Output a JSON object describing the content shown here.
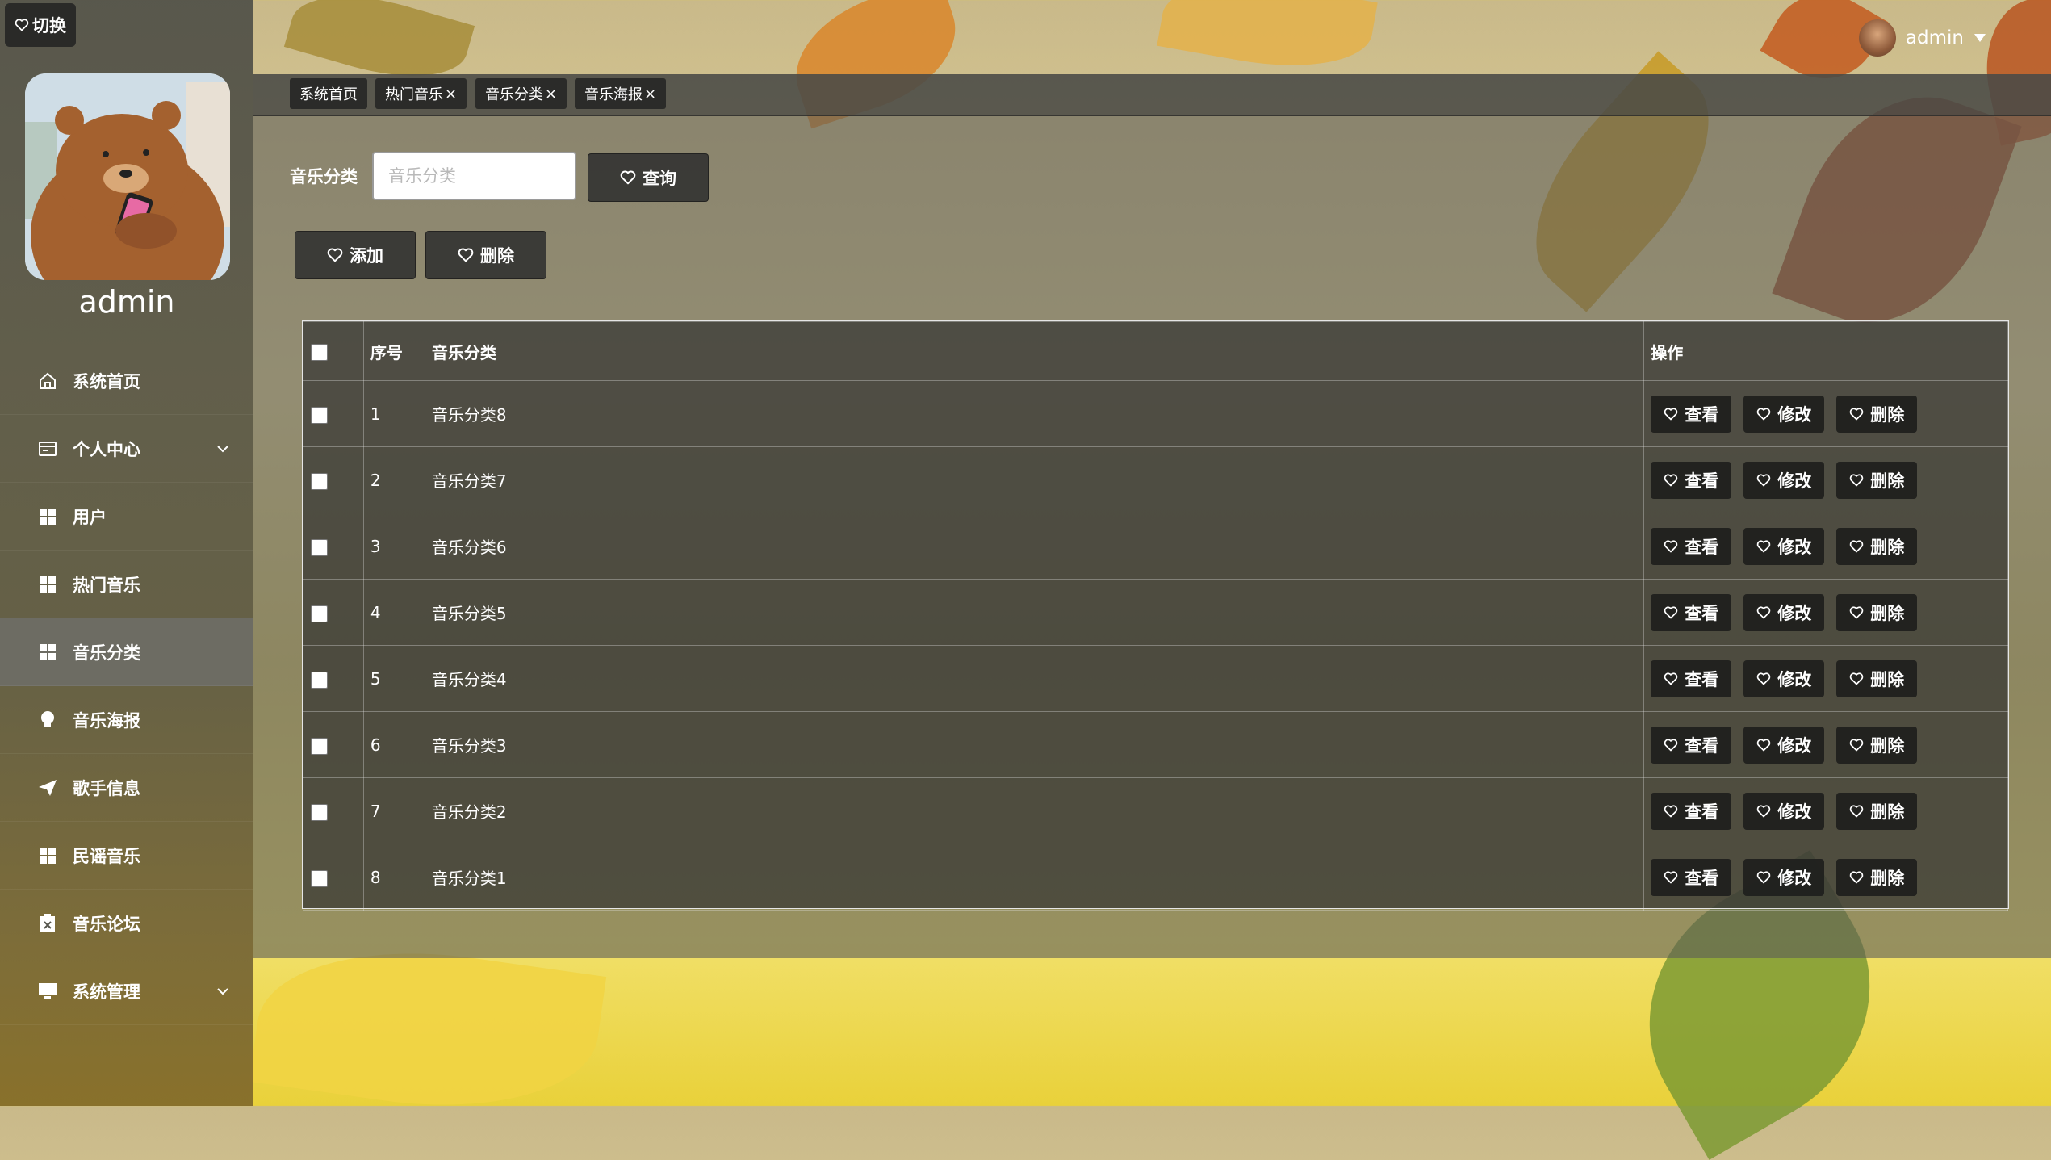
{
  "sidebar": {
    "switch_label": "切换",
    "user_name": "admin",
    "items": [
      {
        "label": "系统首页",
        "icon": "home-icon"
      },
      {
        "label": "个人中心",
        "icon": "id-card-icon",
        "has_submenu": true
      },
      {
        "label": "用户",
        "icon": "grid-icon"
      },
      {
        "label": "热门音乐",
        "icon": "grid-icon"
      },
      {
        "label": "音乐分类",
        "icon": "grid-icon",
        "active": true
      },
      {
        "label": "音乐海报",
        "icon": "bulb-icon"
      },
      {
        "label": "歌手信息",
        "icon": "paper-plane-icon"
      },
      {
        "label": "民谣音乐",
        "icon": "grid-icon"
      },
      {
        "label": "音乐论坛",
        "icon": "clipboard-icon"
      },
      {
        "label": "系统管理",
        "icon": "monitor-icon",
        "has_submenu": true
      }
    ]
  },
  "header": {
    "user_name": "admin"
  },
  "tabs": [
    {
      "label": "系统首页",
      "closable": false
    },
    {
      "label": "热门音乐",
      "closable": true
    },
    {
      "label": "音乐分类",
      "closable": true
    },
    {
      "label": "音乐海报",
      "closable": true
    }
  ],
  "tab_close_glyph": "×",
  "search": {
    "label": "音乐分类",
    "placeholder": "音乐分类",
    "value": "",
    "query_button": "查询"
  },
  "actions": {
    "add_button": "添加",
    "delete_button": "删除"
  },
  "table": {
    "columns": [
      "",
      "序号",
      "音乐分类",
      "操作"
    ],
    "rows": [
      {
        "index": "1",
        "name": "音乐分类8"
      },
      {
        "index": "2",
        "name": "音乐分类7"
      },
      {
        "index": "3",
        "name": "音乐分类6"
      },
      {
        "index": "4",
        "name": "音乐分类5"
      },
      {
        "index": "5",
        "name": "音乐分类4"
      },
      {
        "index": "6",
        "name": "音乐分类3"
      },
      {
        "index": "7",
        "name": "音乐分类2"
      },
      {
        "index": "8",
        "name": "音乐分类1"
      }
    ],
    "row_actions": {
      "view": "查看",
      "edit": "修改",
      "delete": "删除"
    }
  },
  "colors": {
    "sidebar_bg": "#50504a",
    "active_menu_bg": "#6e6e68",
    "button_bg": "#343432",
    "background_accent": "#e9d13a"
  }
}
